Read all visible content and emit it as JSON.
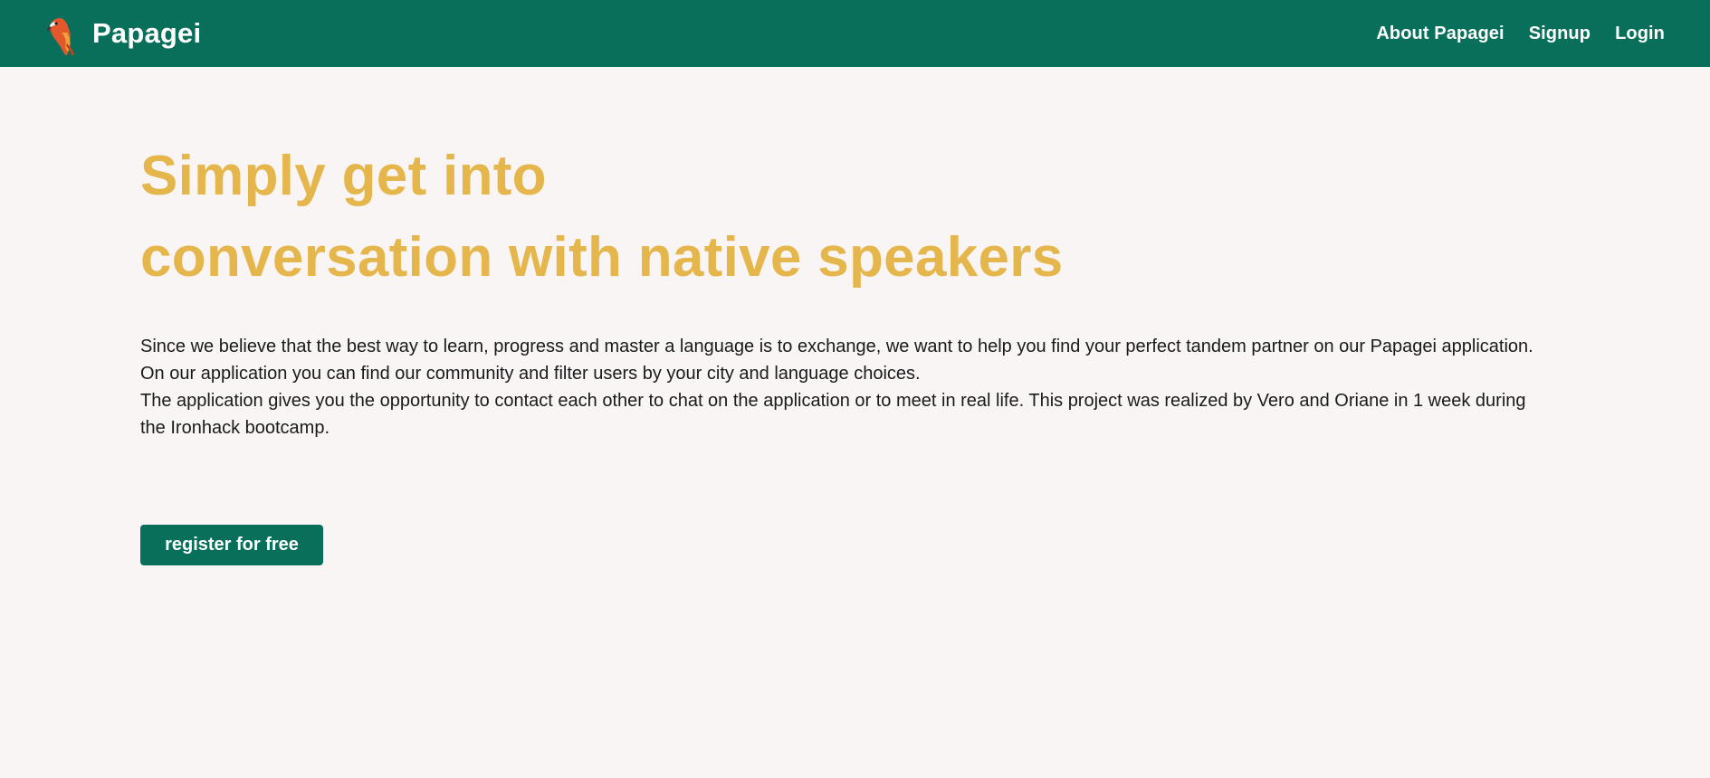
{
  "header": {
    "brand_name": "Papagei",
    "logo_icon": "parrot-icon",
    "nav": [
      {
        "label": "About Papagei"
      },
      {
        "label": "Signup"
      },
      {
        "label": "Login"
      }
    ]
  },
  "hero": {
    "title_line1": "Simply get into",
    "title_line2": "conversation with native speakers",
    "paragraphs": [
      "Since we believe that the best way to learn, progress and master a language is to exchange, we want to help you find your perfect tandem partner on our Papagei application.",
      "On our application you can find our community and filter users by your city and language choices.",
      "The application gives you the opportunity to contact each other to chat on the application or to meet in real life. This project was realized by Vero and Oriane in 1 week during the Ironhack bootcamp."
    ],
    "cta_label": "register for free"
  },
  "colors": {
    "navbar": "#086f5a",
    "title": "#e5b64b",
    "background": "#faf5f5",
    "button": "#086f5a"
  }
}
